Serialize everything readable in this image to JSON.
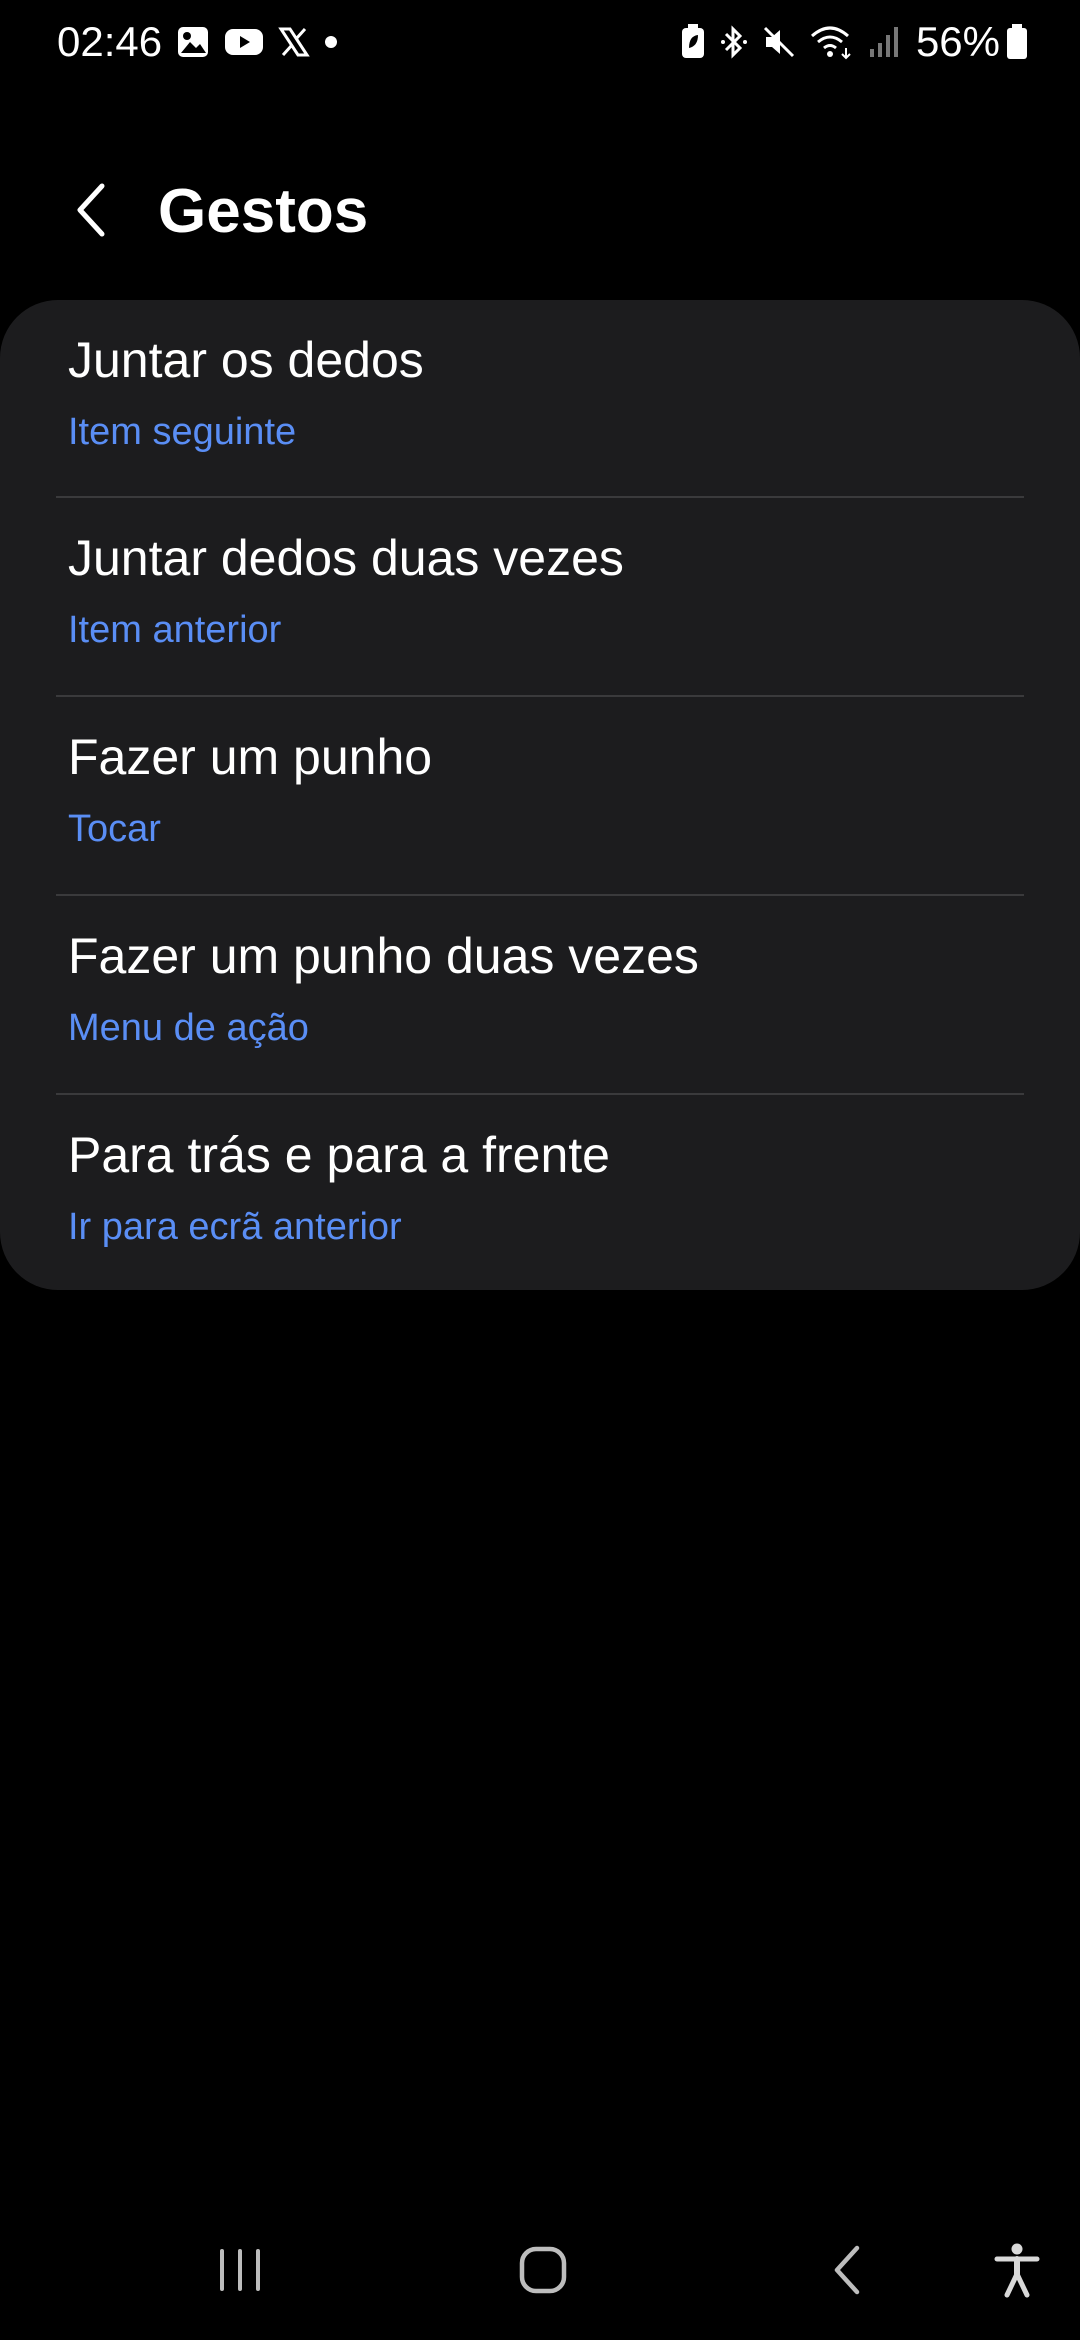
{
  "status_bar": {
    "time": "02:46",
    "left_icons": [
      "gallery-icon",
      "youtube-icon",
      "x-icon",
      "dot-icon"
    ],
    "right_icons": [
      "battery-saver-icon",
      "bluetooth-icon",
      "mute-icon",
      "wifi-icon",
      "signal-icon"
    ],
    "battery_percent": "56%"
  },
  "header": {
    "title": "Gestos"
  },
  "gestures": [
    {
      "title": "Juntar os dedos",
      "subtitle": "Item seguinte"
    },
    {
      "title": "Juntar dedos duas vezes",
      "subtitle": "Item anterior"
    },
    {
      "title": "Fazer um punho",
      "subtitle": "Tocar"
    },
    {
      "title": "Fazer um punho duas vezes",
      "subtitle": "Menu de ação"
    },
    {
      "title": "Para trás e para a frente",
      "subtitle": "Ir para ecrã anterior"
    }
  ],
  "nav_bar": {
    "buttons": [
      "recents-icon",
      "home-icon",
      "back-icon",
      "accessibility-icon"
    ]
  },
  "colors": {
    "background": "#000000",
    "card": "#1c1c1e",
    "accent": "#5a8ef5",
    "divider": "#3a3a3c"
  }
}
